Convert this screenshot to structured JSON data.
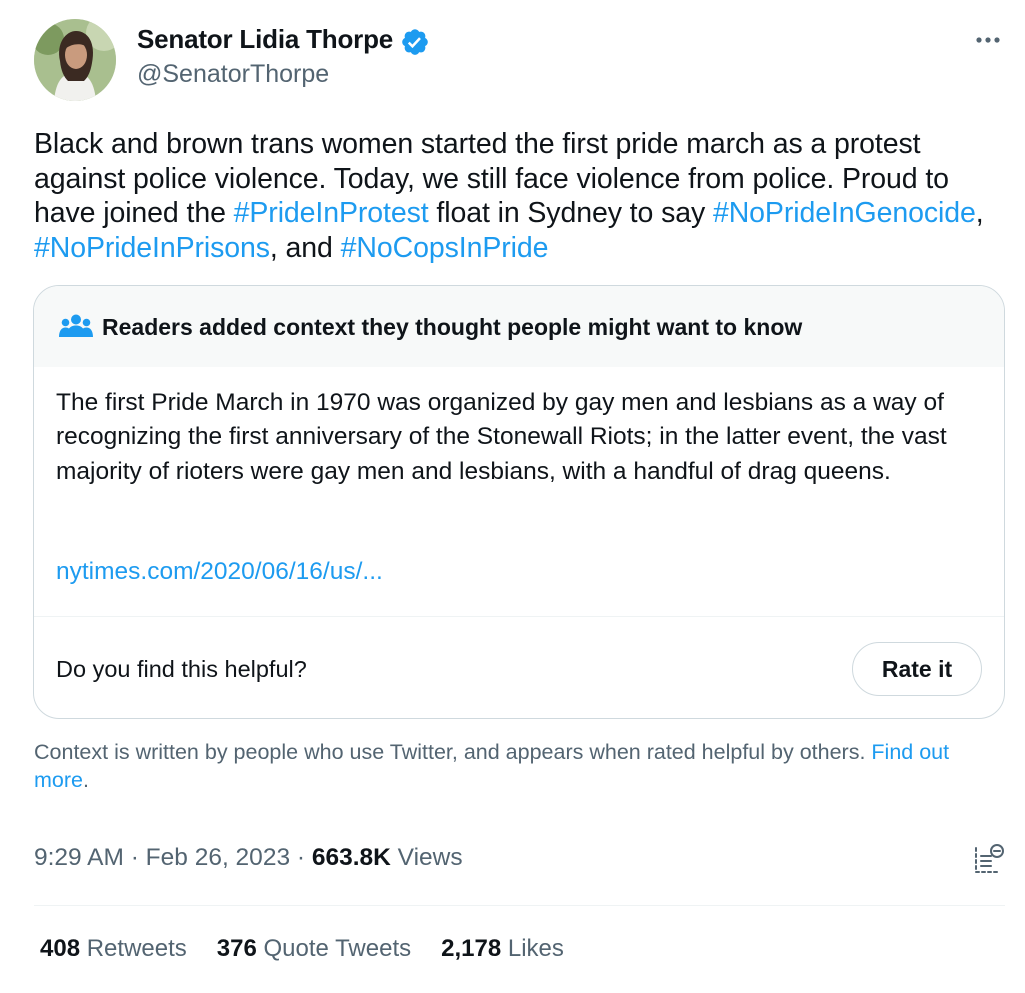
{
  "author": {
    "name": "Senator Lidia Thorpe",
    "handle": "@SenatorThorpe"
  },
  "tweet": {
    "text_1": "Black and brown trans women started the first pride march as a protest against police violence. Today, we still face violence from police. Proud to have joined the ",
    "hashtag_1": "#PrideInProtest",
    "text_2": " float in Sydney to say ",
    "hashtag_2": "#NoPrideInGenocide",
    "text_3": ", ",
    "hashtag_3": "#NoPrideInPrisons",
    "text_4": ", and ",
    "hashtag_4": "#NoCopsInPride"
  },
  "note": {
    "title": "Readers added context they thought people might want to know",
    "body": "The first Pride March in 1970 was organized by gay men and lesbians as a way of recognizing the first anniversary of the Stonewall Riots; in the latter event, the vast majority of rioters were gay men and lesbians, with a handful of drag queens.",
    "link": "nytimes.com/2020/06/16/us/...",
    "helpful_question": "Do you find this helpful?",
    "rate_button": "Rate it"
  },
  "context_footer": {
    "text": "Context is written by people who use Twitter, and appears when rated helpful by others. ",
    "link": "Find out more",
    "end": "."
  },
  "meta": {
    "time": "9:29 AM",
    "separator": " · ",
    "date": "Feb 26, 2023",
    "views_count": "663.8K",
    "views_label": " Views"
  },
  "stats": {
    "retweets_count": "408",
    "retweets_label": " Retweets",
    "quotes_count": "376",
    "quotes_label": " Quote Tweets",
    "likes_count": "2,178",
    "likes_label": " Likes"
  },
  "colors": {
    "link": "#1d9bf0",
    "secondary_text": "#536471",
    "primary_text": "#0f1419",
    "note_header_bg": "#f7f9f9"
  },
  "icons": [
    "verified-badge-icon",
    "more-options-icon",
    "people-icon",
    "analytics-icon"
  ]
}
